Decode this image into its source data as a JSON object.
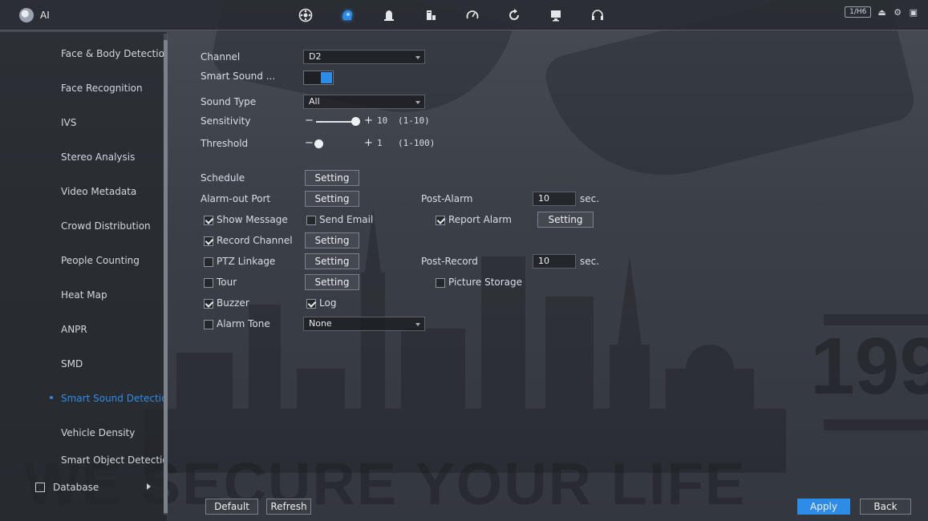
{
  "app": {
    "title": "AI"
  },
  "topbar": {
    "nav_icons": [
      "camera-lens-icon",
      "ai-head-icon",
      "alarm-bell-icon",
      "storage-icon",
      "operation-gauge-icon",
      "maintenance-refresh-icon",
      "monitor-icon",
      "headset-icon"
    ],
    "badge": "1/H6",
    "status_text": "⏏ ⚙ ▣"
  },
  "sidebar": {
    "items": [
      {
        "label": "Face & Body Detection"
      },
      {
        "label": "Face Recognition"
      },
      {
        "label": "IVS"
      },
      {
        "label": "Stereo Analysis"
      },
      {
        "label": "Video Metadata"
      },
      {
        "label": "Crowd Distribution"
      },
      {
        "label": "People Counting"
      },
      {
        "label": "Heat Map"
      },
      {
        "label": "ANPR"
      },
      {
        "label": "SMD"
      },
      {
        "label": "Smart Sound Detection"
      },
      {
        "label": "Vehicle Density"
      },
      {
        "label": "Smart Object Detection"
      }
    ],
    "database": "Database"
  },
  "form": {
    "channel_label": "Channel",
    "channel_value": "D2",
    "smart_sound_label": "Smart Sound ...",
    "smart_sound_enabled": true,
    "sound_type_label": "Sound Type",
    "sound_type_value": "All",
    "sensitivity_label": "Sensitivity",
    "sensitivity_value": "10",
    "sensitivity_range": "(1-10)",
    "threshold_label": "Threshold",
    "threshold_value": "1",
    "threshold_range": "(1-100)",
    "schedule_label": "Schedule",
    "alarm_out_label": "Alarm-out Port",
    "post_alarm_label": "Post-Alarm",
    "post_alarm_value": "10",
    "post_alarm_unit": "sec.",
    "show_message_label": "Show Message",
    "send_email_label": "Send Email",
    "report_alarm_label": "Report Alarm",
    "record_channel_label": "Record Channel",
    "ptz_linkage_label": "PTZ Linkage",
    "post_record_label": "Post-Record",
    "post_record_value": "10",
    "post_record_unit": "sec.",
    "tour_label": "Tour",
    "picture_storage_label": "Picture Storage",
    "buzzer_label": "Buzzer",
    "log_label": "Log",
    "alarm_tone_label": "Alarm Tone",
    "alarm_tone_value": "None",
    "setting_label": "Setting",
    "checks": {
      "show_message": true,
      "send_email": false,
      "report_alarm": true,
      "record_channel": true,
      "ptz_linkage": false,
      "tour": false,
      "picture_storage": false,
      "buzzer": true,
      "log": true,
      "alarm_tone": false
    }
  },
  "footer": {
    "default": "Default",
    "refresh": "Refresh",
    "apply": "Apply",
    "back": "Back"
  },
  "background": {
    "slogan": "WE SECURE YOUR LIFE",
    "number": "199"
  }
}
